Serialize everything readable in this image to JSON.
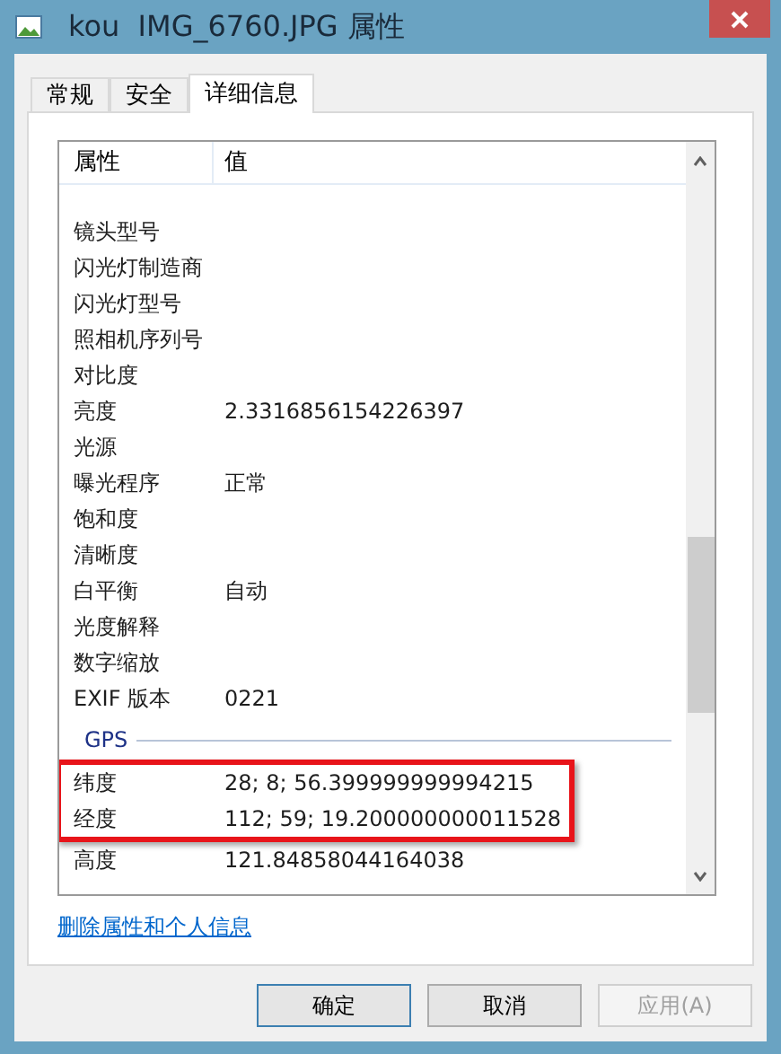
{
  "window": {
    "title": "kou  IMG_6760.JPG 属性"
  },
  "tabs": [
    {
      "label": "常规",
      "selected": false
    },
    {
      "label": "安全",
      "selected": false
    },
    {
      "label": "详细信息",
      "selected": true
    }
  ],
  "table": {
    "columns": [
      "属性",
      "值"
    ],
    "groups": [
      {
        "rows": [
          {
            "property": "镜头型号",
            "value": "",
            "highlighted": false
          },
          {
            "property": "闪光灯制造商",
            "value": "",
            "highlighted": false
          },
          {
            "property": "闪光灯型号",
            "value": "",
            "highlighted": false
          },
          {
            "property": "照相机序列号",
            "value": "",
            "highlighted": false
          },
          {
            "property": "对比度",
            "value": "",
            "highlighted": false
          },
          {
            "property": "亮度",
            "value": "2.3316856154226397",
            "highlighted": false
          },
          {
            "property": "光源",
            "value": "",
            "highlighted": false
          },
          {
            "property": "曝光程序",
            "value": "正常",
            "highlighted": false
          },
          {
            "property": "饱和度",
            "value": "",
            "highlighted": false
          },
          {
            "property": "清晰度",
            "value": "",
            "highlighted": false
          },
          {
            "property": "白平衡",
            "value": "自动",
            "highlighted": false
          },
          {
            "property": "光度解释",
            "value": "",
            "highlighted": false
          },
          {
            "property": "数字缩放",
            "value": "",
            "highlighted": false
          },
          {
            "property": "EXIF 版本",
            "value": "0221",
            "highlighted": false
          }
        ]
      },
      {
        "title": "GPS",
        "rows": [
          {
            "property": "纬度",
            "value": "28; 8; 56.399999999994215",
            "highlighted": true
          },
          {
            "property": "经度",
            "value": "112; 59; 19.200000000011528",
            "highlighted": true
          },
          {
            "property": "高度",
            "value": "121.84858044164038",
            "highlighted": false
          }
        ]
      }
    ]
  },
  "link": "删除属性和个人信息",
  "buttons": [
    {
      "label": "确定",
      "default": true,
      "disabled": false
    },
    {
      "label": "取消",
      "default": false,
      "disabled": false
    },
    {
      "label": "应用(A)",
      "default": false,
      "disabled": true
    }
  ]
}
